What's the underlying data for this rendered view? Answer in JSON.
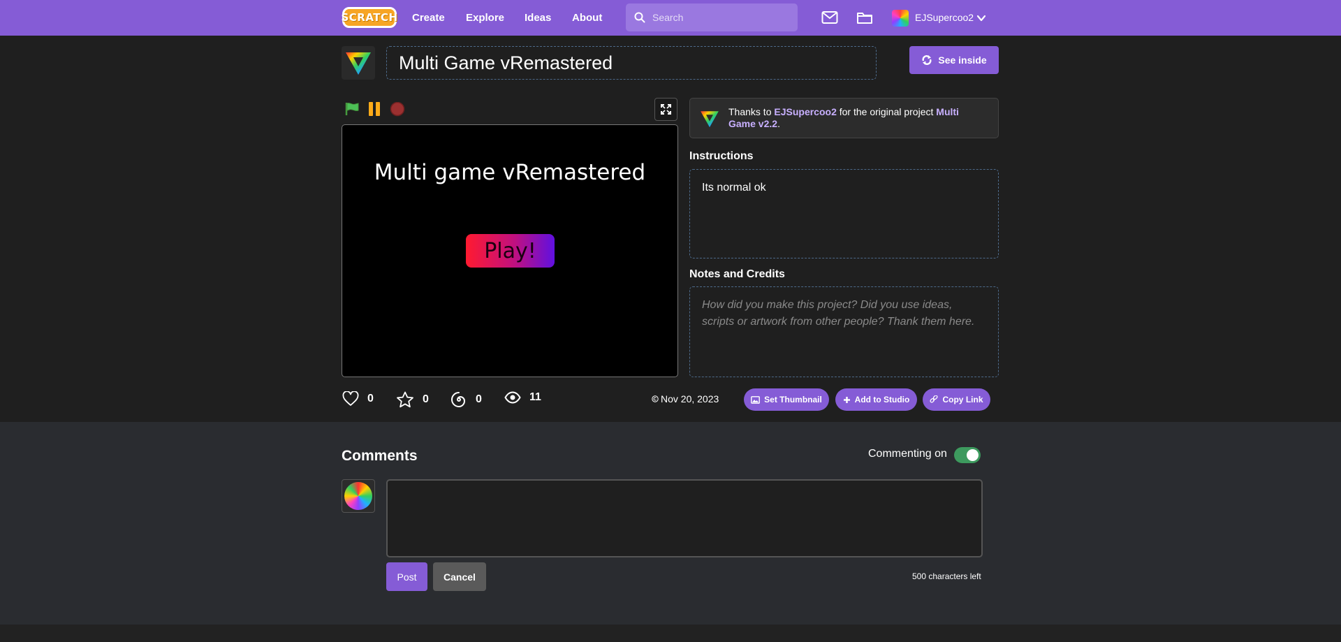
{
  "nav": {
    "logo": "SCRATCH",
    "links": [
      "Create",
      "Explore",
      "Ideas",
      "About"
    ],
    "search_placeholder": "Search",
    "username": "EJSupercoo2"
  },
  "project": {
    "title": "Multi Game vRemastered",
    "see_inside_label": "See inside",
    "stage_title": "Multi game vRemastered",
    "stage_button": "Play!"
  },
  "credit": {
    "prefix": "Thanks to",
    "author": "EJSupercoo2",
    "middle": "for the original project",
    "original_project": "Multi Game v2.2",
    "suffix": "."
  },
  "instructions": {
    "label": "Instructions",
    "text": "Its normal ok"
  },
  "notes": {
    "label": "Notes and Credits",
    "placeholder": "How did you make this project? Did you use ideas, scripts or artwork from other people? Thank them here."
  },
  "stats": {
    "loves": "0",
    "favorites": "0",
    "remixes": "0",
    "views": "11"
  },
  "date": "Nov 20, 2023",
  "actions": {
    "set_thumbnail": "Set Thumbnail",
    "add_to_studio": "Add to Studio",
    "copy_link": "Copy Link"
  },
  "comments": {
    "title": "Comments",
    "commenting_label": "Commenting on",
    "commenting_enabled": true,
    "post_label": "Post",
    "cancel_label": "Cancel",
    "chars_left": "500 characters left"
  },
  "colors": {
    "brand": "#855cd6",
    "background": "#1f1f1f",
    "comments_background": "#2a2c30",
    "toggle_on": "#3d9a5e"
  }
}
